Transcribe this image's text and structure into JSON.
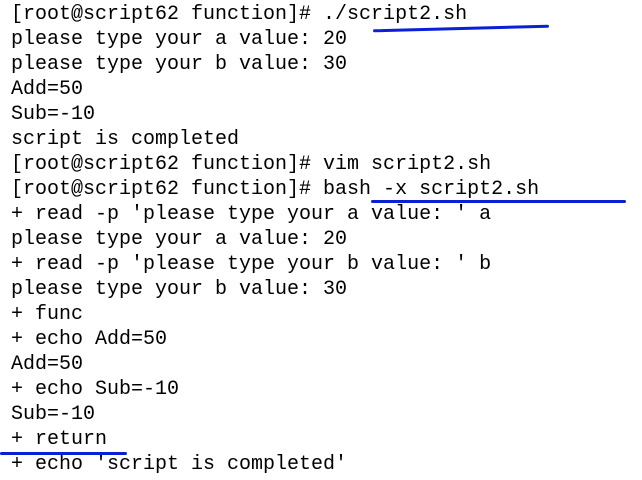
{
  "terminal": {
    "lines": [
      "[root@script62 function]# ./script2.sh",
      "please type your a value: 20",
      "please type your b value: 30",
      "Add=50",
      "Sub=-10",
      "script is completed",
      "[root@script62 function]# vim script2.sh",
      "[root@script62 function]# bash -x script2.sh",
      "+ read -p 'please type your a value: ' a",
      "please type your a value: 20",
      "+ read -p 'please type your b value: ' b",
      "please type your b value: 30",
      "+ func",
      "+ echo Add=50",
      "Add=50",
      "+ echo Sub=-10",
      "Sub=-10",
      "+ return",
      "+ echo 'script is completed'"
    ]
  },
  "colors": {
    "background": "#ffffff",
    "text": "#000000",
    "annotation_underline": "#0a1fd6"
  }
}
